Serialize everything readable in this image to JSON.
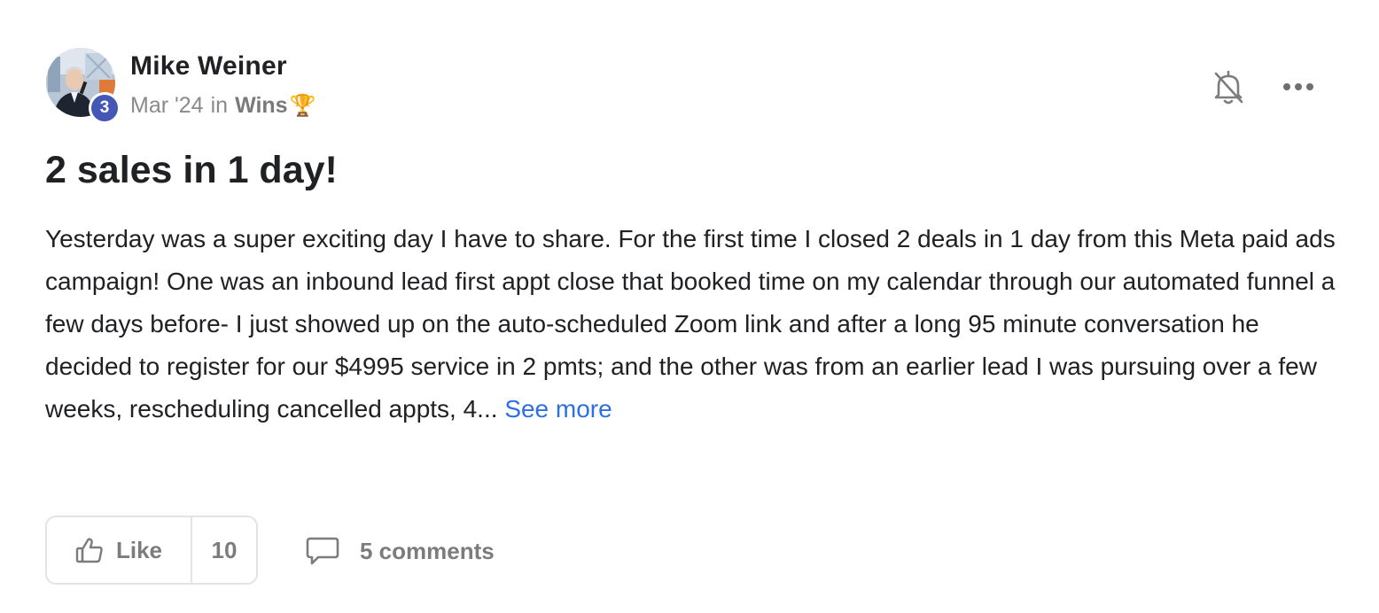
{
  "post": {
    "author": {
      "name": "Mike Weiner",
      "level": "3",
      "avatar_icon": "user-photo-avatar"
    },
    "meta": {
      "date": "Mar '24",
      "in_label": "in",
      "category": "Wins",
      "category_emoji": "🏆"
    },
    "title": "2 sales in 1 day!",
    "body": "Yesterday was a super exciting day I have to share. For the first time I closed 2 deals in 1 day from this Meta paid ads campaign! One was an inbound lead first appt close that booked time on my calendar through our automated funnel a few days before- I just showed up on the auto-scheduled Zoom link and after a long 95 minute conversation he decided to register for our $4995 service in 2 pmts; and the other was from an earlier lead I was pursuing over a few weeks, rescheduling cancelled appts, 4...",
    "see_more_label": "See more",
    "actions": {
      "bell_icon": "bell-off-icon",
      "more_icon": "more-horizontal-icon",
      "like_label": "Like",
      "like_count": "10",
      "comments_label": "5 comments"
    }
  },
  "colors": {
    "text": "#202124",
    "muted": "#8a8a8a",
    "link": "#2f6fe4",
    "badge": "#4457b5",
    "border": "#e3e3e3"
  }
}
